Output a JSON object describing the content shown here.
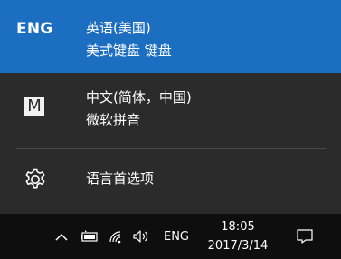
{
  "language_flyout": {
    "items": [
      {
        "code": "ENG",
        "name": "英语(美国)",
        "keyboard": "美式键盘 键盘",
        "selected": true
      },
      {
        "code_icon": "M",
        "name": "中文(简体，中国)",
        "keyboard": "微软拼音",
        "selected": false
      }
    ],
    "preferences_label": "语言首选项",
    "highlight_color": "#1c6ec1",
    "background_color": "#2b2b2b"
  },
  "taskbar": {
    "tray_icons": [
      "chevron-up-icon",
      "battery-icon",
      "wifi-icon",
      "volume-icon"
    ],
    "input_indicator": "ENG",
    "clock": {
      "time": "18:05",
      "date": "2017/3/14"
    },
    "notification_icon": "action-center-icon"
  }
}
